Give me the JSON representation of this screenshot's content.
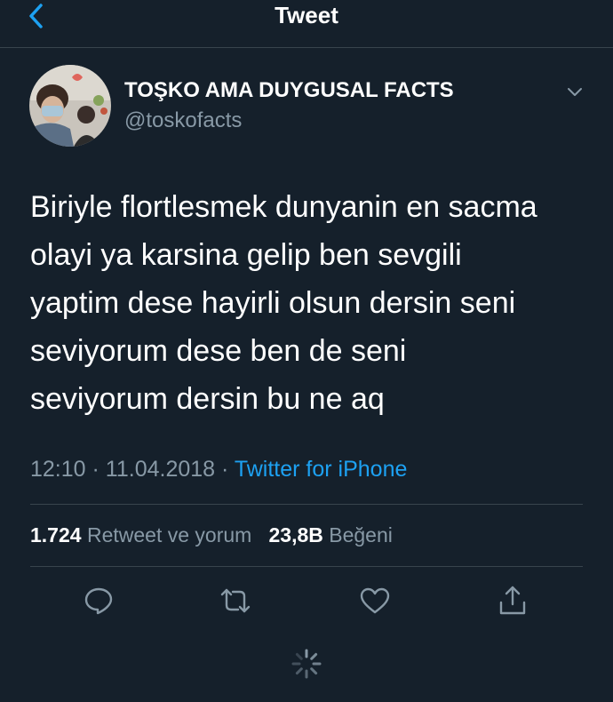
{
  "nav": {
    "title": "Tweet",
    "back_icon": "chevron-left-icon"
  },
  "author": {
    "display_name": "TOŞKO AMA DUYGUSAL FACTS",
    "handle": "@toskofacts"
  },
  "tweet": {
    "lines": [
      "Biriyle flortlesmek dunyanin en sacma",
      "olayi ya karsina gelip ben sevgili",
      "yaptim dese hayirli olsun dersin seni",
      "seviyorum dese ben de seni",
      "seviyorum dersin bu ne aq"
    ],
    "time": "12:10",
    "separator": "·",
    "date": "11.04.2018",
    "source": "Twitter for iPhone"
  },
  "stats": {
    "retweets_count": "1.724",
    "retweets_label": "Retweet ve yorum",
    "likes_count": "23,8B",
    "likes_label": "Beğeni"
  },
  "actions": {
    "icons": [
      "reply-icon",
      "retweet-icon",
      "like-icon",
      "share-icon"
    ]
  },
  "colors": {
    "background": "#15202b",
    "accent": "#1da1f2",
    "secondary_text": "#8899a6",
    "divider": "#38444d"
  }
}
